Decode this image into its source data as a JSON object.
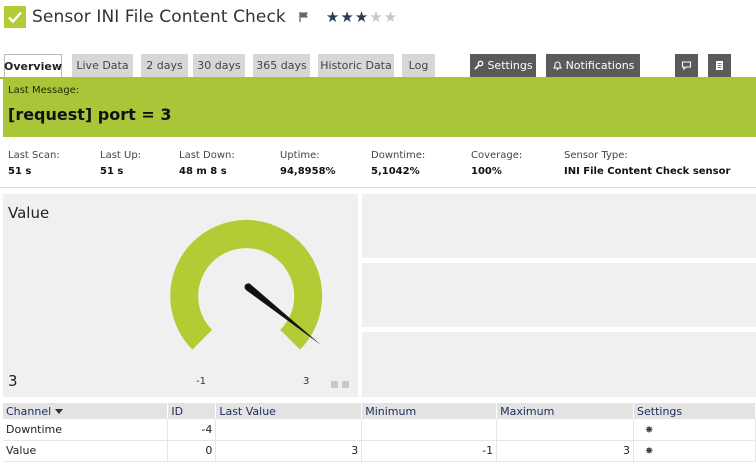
{
  "header": {
    "title": "Sensor INI File Content Check",
    "stars_total": 5,
    "stars_filled": 3
  },
  "tabs": [
    {
      "label": "Overview",
      "active": true
    },
    {
      "label": "Live Data"
    },
    {
      "label": "2 days"
    },
    {
      "label": "30 days"
    },
    {
      "label": "365 days"
    },
    {
      "label": "Historic Data"
    },
    {
      "label": "Log"
    },
    {
      "label": "Settings"
    },
    {
      "label": "Notifications"
    }
  ],
  "message": {
    "label": "Last Message:",
    "text": "[request] port = 3"
  },
  "stats": [
    {
      "key": "Last Scan:",
      "value": "51 s"
    },
    {
      "key": "Last Up:",
      "value": "51 s"
    },
    {
      "key": "Last Down:",
      "value": "48 m 8 s"
    },
    {
      "key": "Uptime:",
      "value": "94,8958%"
    },
    {
      "key": "Downtime:",
      "value": "5,1042%"
    },
    {
      "key": "Coverage:",
      "value": "100%"
    },
    {
      "key": "Sensor Type:",
      "value": "INI File Content Check sensor"
    }
  ],
  "gauge": {
    "label": "Value",
    "value": "3",
    "min": "-1",
    "max": "3",
    "color": "#b3cc36"
  },
  "table": {
    "headers": [
      "Channel",
      "ID",
      "Last Value",
      "Minimum",
      "Maximum",
      "Settings"
    ],
    "rows": [
      {
        "channel": "Downtime",
        "id": "-4",
        "last": "",
        "min": "",
        "max": ""
      },
      {
        "channel": "Value",
        "id": "0",
        "last": "3",
        "min": "-1",
        "max": "3"
      }
    ]
  },
  "colors": {
    "accent": "#a8c638",
    "tab_dark": "#5a5a5a"
  }
}
